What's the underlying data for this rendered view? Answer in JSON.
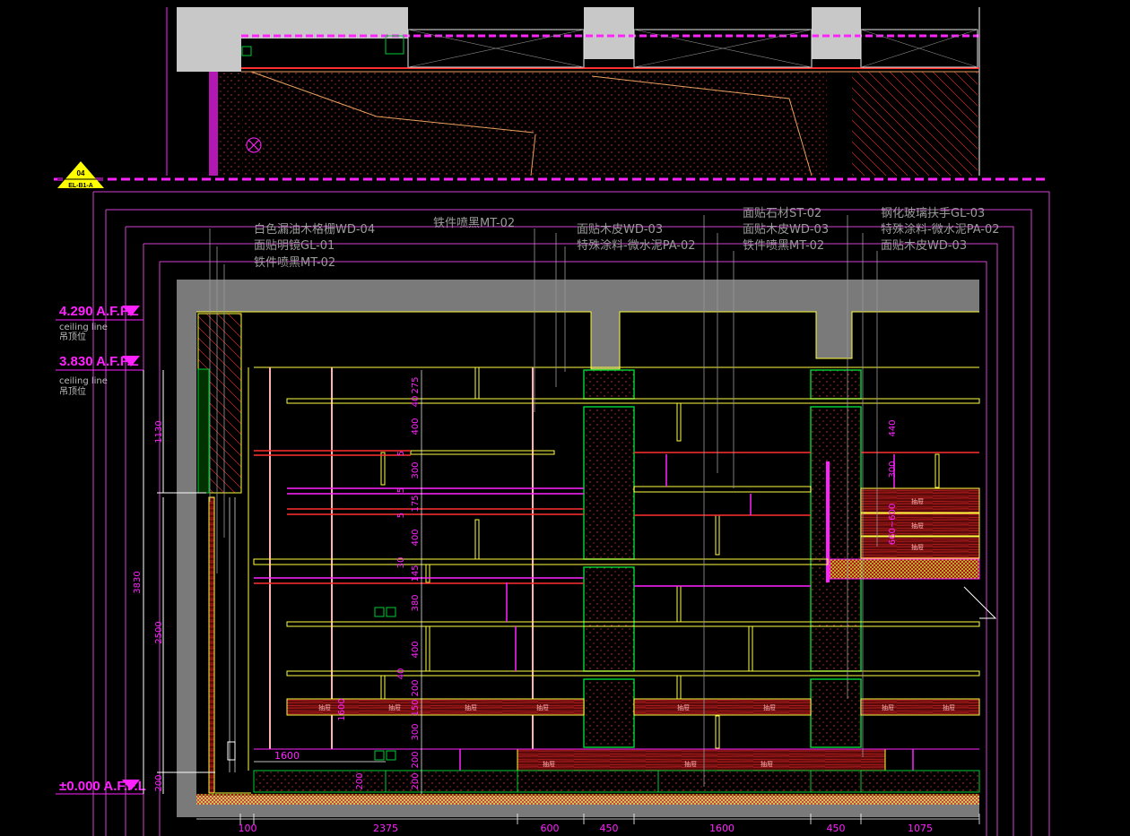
{
  "drawing": {
    "section_marker": {
      "number": "04",
      "sheet": "EL-B1-A"
    },
    "levels": [
      {
        "value": "4.290 A.F.F.L",
        "note_en": "ceiling line",
        "note_cn": "吊顶位"
      },
      {
        "value": "3.830 A.F.F.L",
        "note_en": "ceiling line",
        "note_cn": "吊顶位"
      },
      {
        "value": "±0.000 A.F.F.L",
        "note_en": "",
        "note_cn": ""
      }
    ],
    "material_labels": [
      "白色漏油木格栅WD-04",
      "面贴明镜GL-01",
      "铁件喷黑MT-02",
      "铁件喷黑MT-02",
      "面贴木皮WD-03",
      "特殊涂料-微水泥PA-02",
      "面贴石材ST-02",
      "面贴木皮WD-03",
      "铁件喷黑MT-02",
      "钢化玻璃扶手GL-03",
      "特殊涂料-微水泥PA-02",
      "面贴木皮WD-03"
    ],
    "dimensions_left": [
      "1130",
      "3830",
      "2500",
      "200"
    ],
    "dimensions_vertical": [
      "275",
      "40",
      "400",
      "5",
      "300",
      "5",
      "175",
      "5",
      "400",
      "30",
      "145",
      "380",
      "400",
      "40",
      "200",
      "150",
      "300",
      "200",
      "200",
      "1600",
      "200"
    ],
    "dimensions_right": [
      "440",
      "300",
      "660~600"
    ],
    "dimensions_bottom": [
      "100",
      "2375",
      "600",
      "450",
      "1600",
      "450",
      "1075"
    ],
    "inline_dims": [
      "1600"
    ],
    "drawer_label": "抽屉"
  },
  "colors": {
    "background": "#000000",
    "dimension": "#ff22ff",
    "wall_section": "#7a7a7a",
    "wood": "#e8a060",
    "shelf_yellow": "#ffff40",
    "magenta": "#ff22ff",
    "red_line": "#ff3030",
    "green": "#00cc33",
    "gray_text": "#9a9a9a"
  }
}
